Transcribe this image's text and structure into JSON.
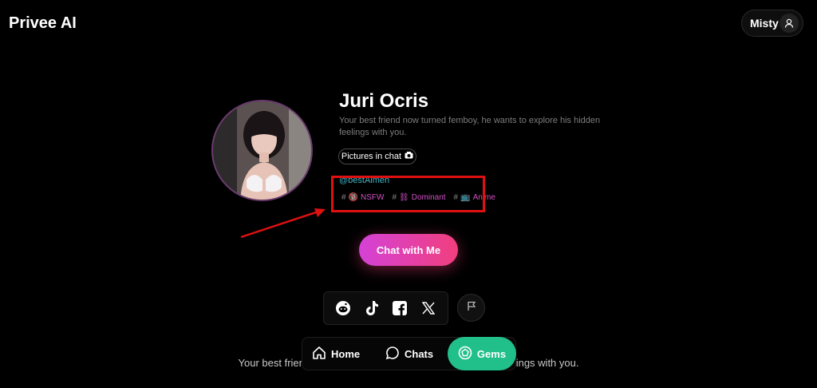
{
  "app": {
    "title": "Privee AI"
  },
  "user": {
    "name": "Misty",
    "icon": "user-icon"
  },
  "character": {
    "name": "Juri Ocris",
    "description": "Your best friend now turned femboy, he wants to explore his hidden feelings with you.",
    "pictures_badge": "Pictures in chat",
    "handle": "@bestAlmen",
    "tags": [
      {
        "hash": "#",
        "emoji": "🔞",
        "label": "NSFW"
      },
      {
        "hash": "#",
        "emoji": "⛓",
        "label": "Dominant"
      },
      {
        "hash": "#",
        "emoji": "📺",
        "label": "Anime"
      }
    ]
  },
  "cta": {
    "label": "Chat with Me"
  },
  "social": [
    "reddit-icon",
    "tiktok-icon",
    "facebook-icon",
    "x-icon"
  ],
  "bottom": {
    "left_text": "Your best friend nov",
    "right_text": "en feelings with you."
  },
  "nav": {
    "home": "Home",
    "chats": "Chats",
    "gems": "Gems"
  },
  "colors": {
    "accent_pink": "#e0449e",
    "accent_green": "#21c08a",
    "handle": "#3fb8c9",
    "annotation": "#e01010"
  }
}
